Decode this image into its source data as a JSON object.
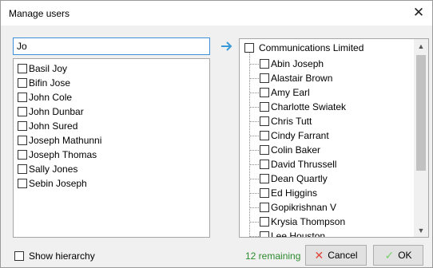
{
  "window": {
    "title": "Manage users",
    "close_glyph": "✕"
  },
  "search": {
    "value": "Jo"
  },
  "left_list": {
    "items": [
      "Basil Joy",
      "Bifin Jose",
      "John Cole",
      "John Dunbar",
      "John Sured",
      "Joseph Mathunni",
      "Joseph Thomas",
      "Sally Jones",
      "Sebin Joseph"
    ]
  },
  "transfer_arrow": {
    "icon": "arrow-right-icon",
    "color": "#3a9ad9"
  },
  "tree": {
    "root": "Communications Limited",
    "children": [
      "Abin Joseph",
      "Alastair Brown",
      "Amy Earl",
      "Charlotte Swiatek",
      "Chris Tutt",
      "Cindy Farrant",
      "Colin Baker",
      "David Thrussell",
      "Dean Quartly",
      "Ed Higgins",
      "Gopikrishnan V",
      "Krysia Thompson",
      "Lee Houston"
    ]
  },
  "footer": {
    "show_hierarchy": "Show hierarchy",
    "remaining": "12 remaining",
    "remaining_color": "#2e8b2e",
    "cancel": "Cancel",
    "ok": "OK"
  }
}
